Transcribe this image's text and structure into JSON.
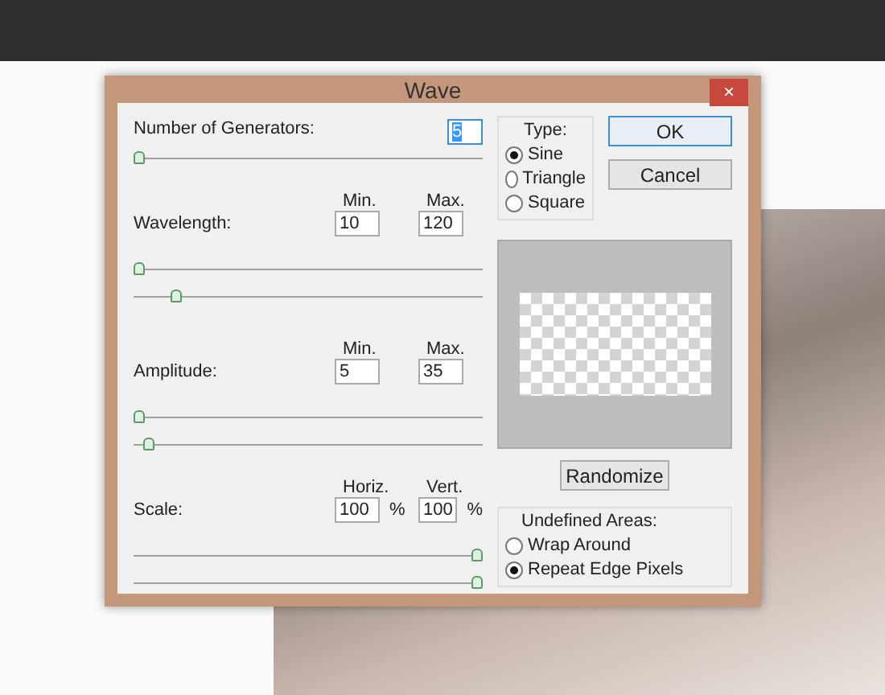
{
  "window": {
    "title": "Wave",
    "close_glyph": "×"
  },
  "generators": {
    "label": "Number of Generators:",
    "value": "5",
    "value_selected": true,
    "slider": {
      "level": 0
    }
  },
  "wavelength": {
    "label": "Wavelength:",
    "min_label": "Min.",
    "max_label": "Max.",
    "min": "10",
    "max": "120",
    "sliders": [
      {
        "level": 0
      },
      {
        "level": 0.11
      }
    ]
  },
  "amplitude": {
    "label": "Amplitude:",
    "min_label": "Min.",
    "max_label": "Max.",
    "min": "5",
    "max": "35",
    "sliders": [
      {
        "level": 0
      },
      {
        "level": 0.03
      }
    ]
  },
  "scale": {
    "label": "Scale:",
    "horiz_label": "Horiz.",
    "vert_label": "Vert.",
    "horiz": "100",
    "horiz_unit": "%",
    "vert": "100",
    "vert_unit": "%",
    "sliders": [
      {
        "level": 1
      },
      {
        "level": 1
      }
    ]
  },
  "type": {
    "title": "Type:",
    "options": [
      {
        "label": "Sine",
        "selected": true
      },
      {
        "label": "Triangle",
        "selected": false
      },
      {
        "label": "Square",
        "selected": false
      }
    ]
  },
  "buttons": [
    {
      "label": "OK",
      "focused": true
    },
    {
      "label": "Cancel",
      "focused": false
    }
  ],
  "randomize": "Randomize",
  "undefined_areas": {
    "title": "Undefined Areas:",
    "options": [
      {
        "label": "Wrap Around",
        "selected": false
      },
      {
        "label": "Repeat Edge Pixels",
        "selected": true
      }
    ]
  }
}
